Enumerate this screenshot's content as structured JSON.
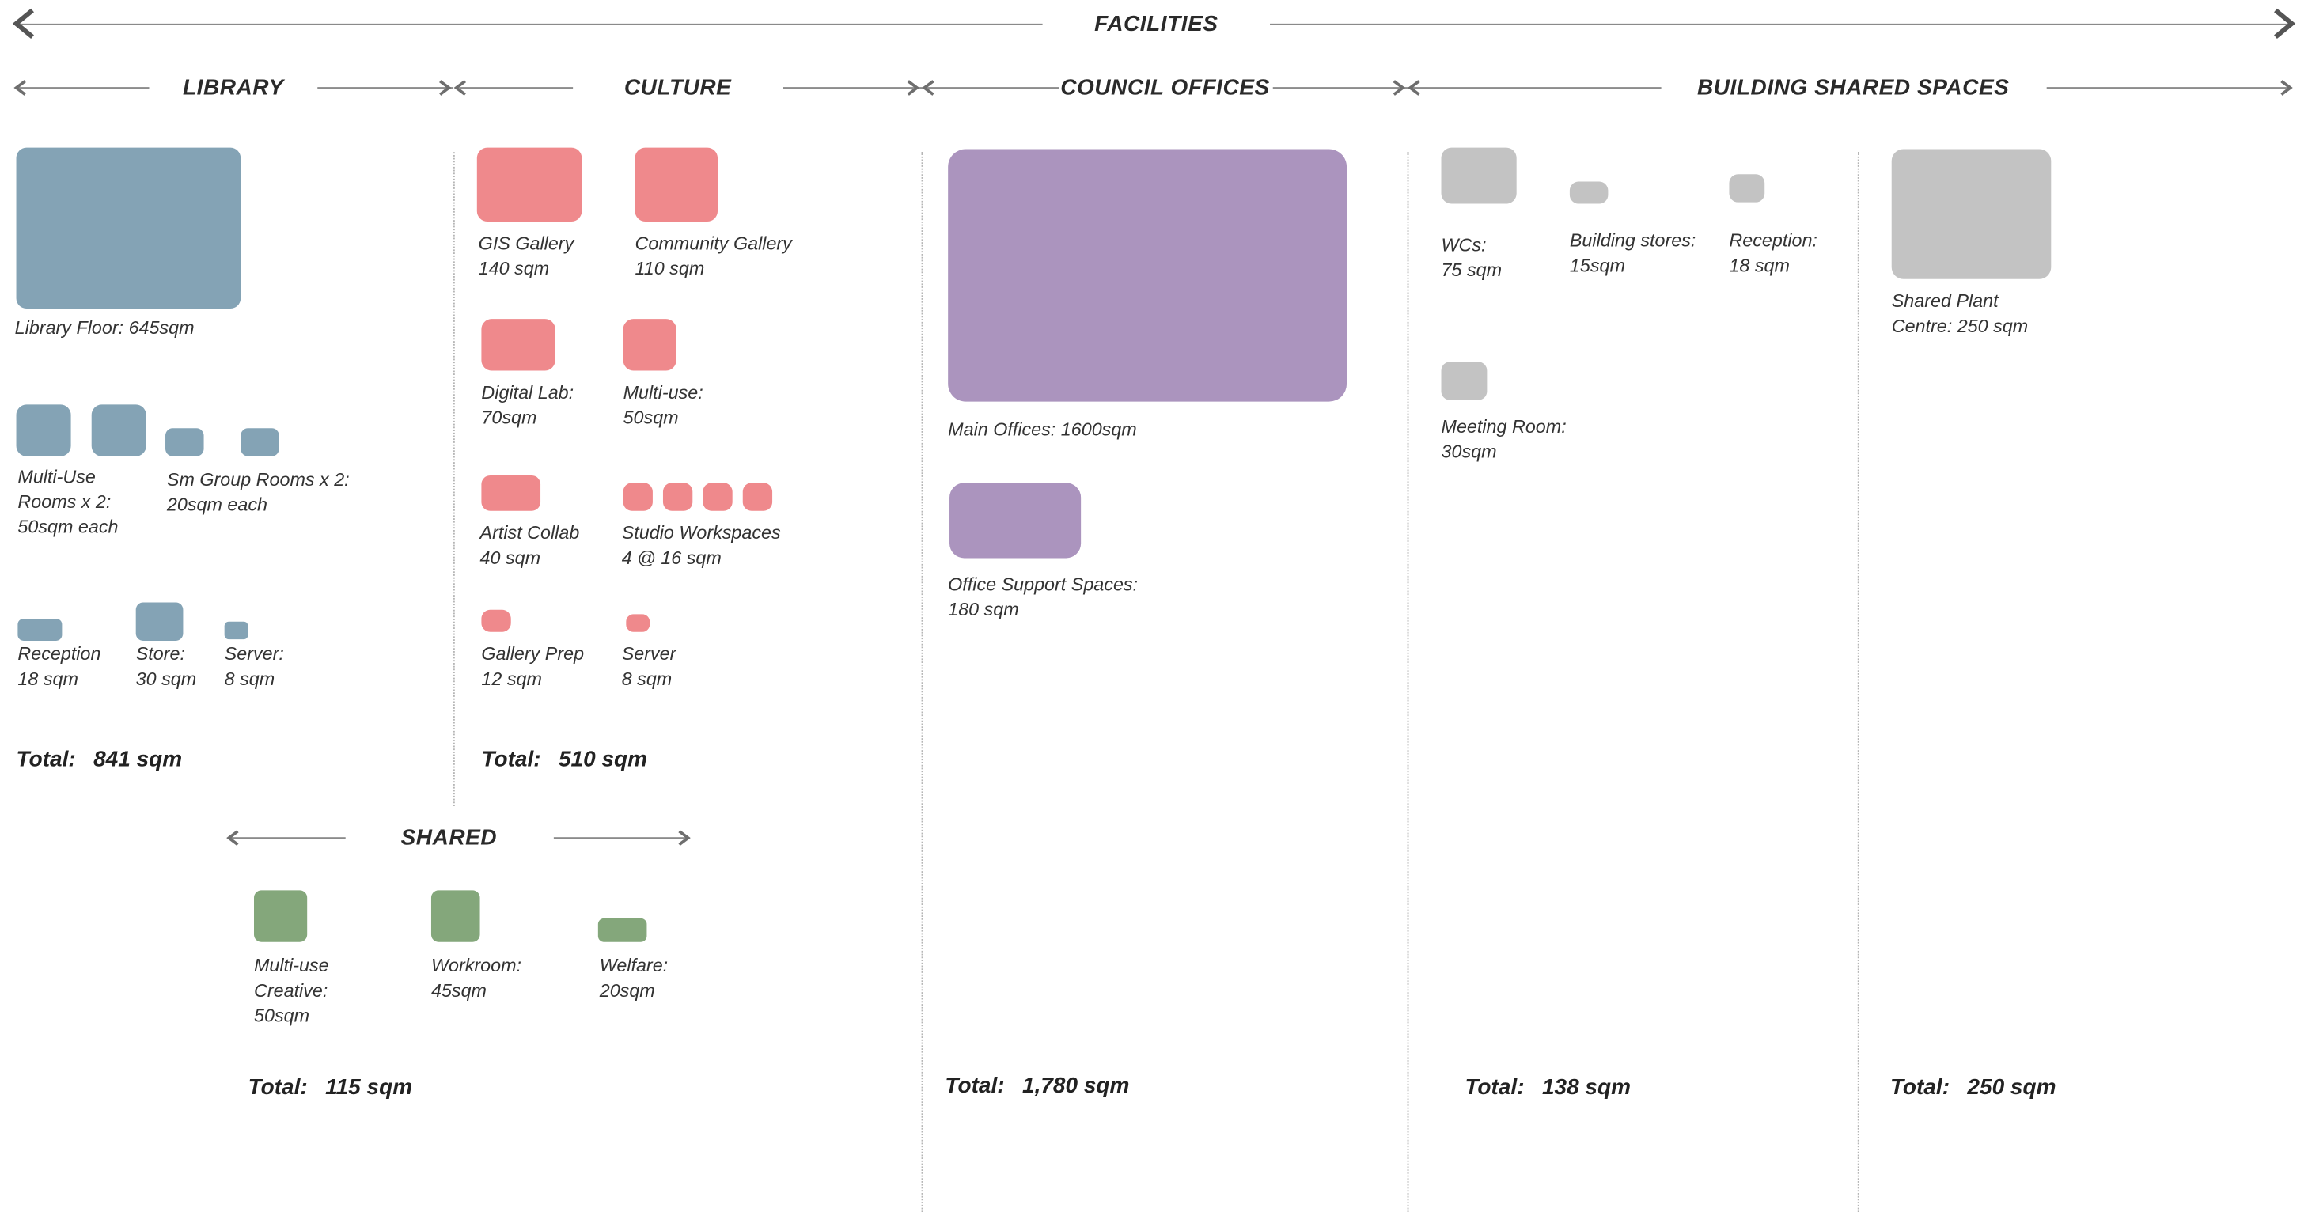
{
  "facilities": {
    "title": "FACILITIES",
    "library": {
      "heading": "LIBRARY",
      "items": {
        "floor": "Library Floor: 645sqm",
        "multi_use": "Multi-Use\nRooms x 2:\n50sqm each",
        "group_rooms": "Sm Group Rooms x 2:\n20sqm each",
        "reception": "Reception\n18 sqm",
        "store": "Store:\n30 sqm",
        "server": "Server:\n8 sqm"
      },
      "total_label": "Total:",
      "total_value": "841 sqm"
    },
    "culture": {
      "heading": "CULTURE",
      "items": {
        "gis": "GIS Gallery\n140 sqm",
        "community": "Community Gallery\n110 sqm",
        "digital": "Digital Lab:\n70sqm",
        "multi_use": "Multi-use:\n50sqm",
        "artist": "Artist Collab\n40 sqm",
        "studio": "Studio Workspaces\n4 @ 16 sqm",
        "prep": "Gallery Prep\n12 sqm",
        "server": "Server\n8 sqm"
      },
      "total_label": "Total:",
      "total_value": "510 sqm"
    },
    "shared": {
      "heading": "SHARED",
      "items": {
        "creative": "Multi-use\nCreative:\n50sqm",
        "workroom": "Workroom:\n45sqm",
        "welfare": "Welfare:\n20sqm"
      },
      "total_label": "Total:",
      "total_value": "115 sqm"
    },
    "council": {
      "heading": "COUNCIL OFFICES",
      "items": {
        "main": "Main Offices: 1600sqm",
        "support": "Office Support Spaces:\n180 sqm"
      },
      "total_label": "Total:",
      "total_value": "1,780 sqm"
    },
    "building": {
      "heading": "BUILDING SHARED SPACES",
      "items": {
        "wcs": "WCs:\n75 sqm",
        "stores": "Building stores:\n15sqm",
        "reception": "Reception:\n18 sqm",
        "meeting": "Meeting Room:\n30sqm",
        "plant": "Shared Plant\nCentre: 250 sqm"
      },
      "total_label": "Total:",
      "total_value": "138 sqm",
      "plant_total_label": "Total:",
      "plant_total_value": "250 sqm"
    }
  },
  "colors": {
    "library": "#84a3b5",
    "culture": "#ef898c",
    "council": "#ab94be",
    "building": "#c3c3c3",
    "shared": "#84a77b"
  }
}
